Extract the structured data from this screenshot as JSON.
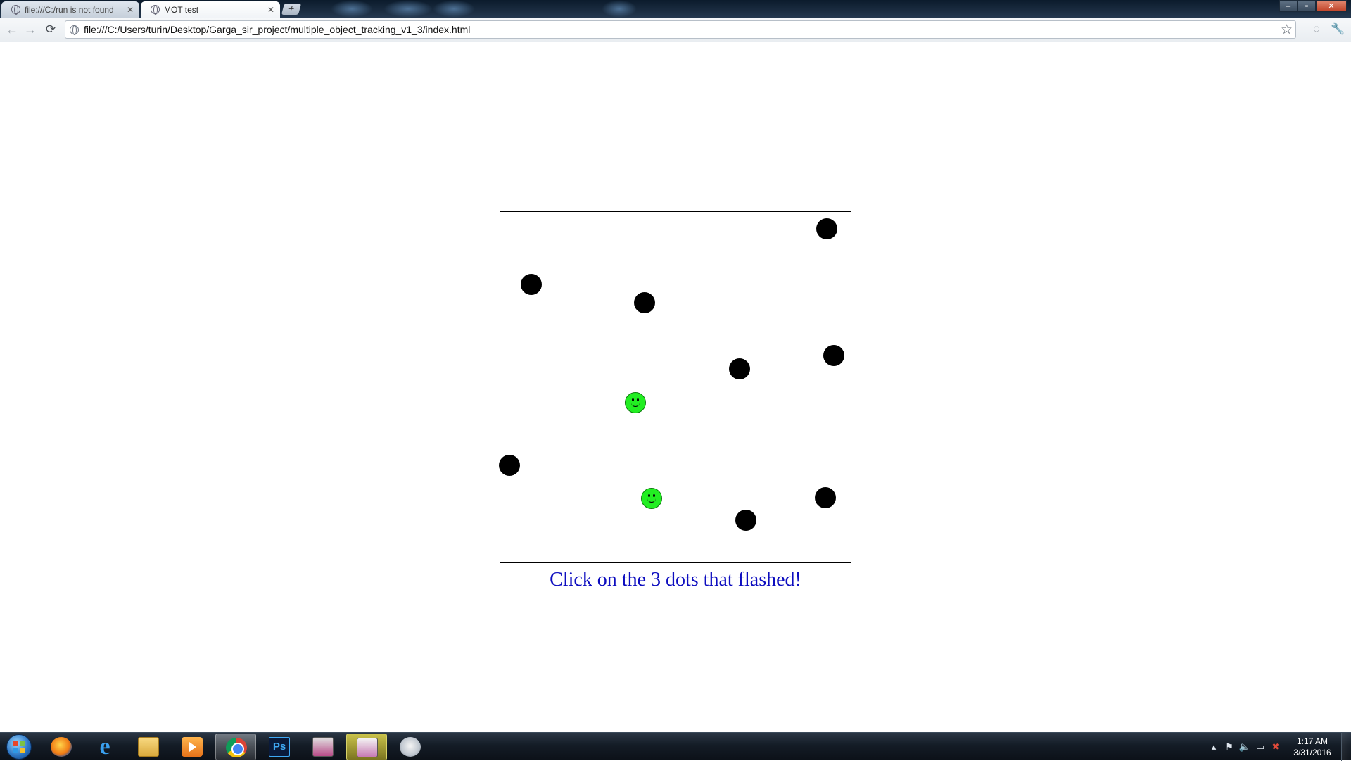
{
  "browser": {
    "tabs": [
      {
        "label": "file:///C:/run is not found",
        "active": false
      },
      {
        "label": "MOT test",
        "active": true
      }
    ],
    "new_tab_glyph": "+",
    "window_controls": {
      "minimize": "–",
      "maximize": "▫",
      "close": "✕"
    },
    "toolbar": {
      "back_glyph": "←",
      "forward_glyph": "→",
      "reload_glyph": "⟳",
      "url": "file:///C:/Users/turin/Desktop/Garga_sir_project/multiple_object_tracking_v1_3/index.html",
      "star_glyph": "☆",
      "extension_glyph": "◌",
      "wrench_glyph": "🔧"
    }
  },
  "page": {
    "instruction": "Click on the 3 dots that flashed!",
    "colors": {
      "dot": "#000000",
      "selected_dot": "#22ee22",
      "instruction_text": "#0d0dbf"
    }
  },
  "taskbar": {
    "apps": [
      {
        "name": "firefox",
        "icon": "firefox-icon"
      },
      {
        "name": "internet-explorer",
        "icon": "ie-icon",
        "glyph": "e"
      },
      {
        "name": "file-explorer",
        "icon": "folder-icon"
      },
      {
        "name": "media-player",
        "icon": "media-player-icon"
      },
      {
        "name": "chrome",
        "icon": "chrome-icon"
      },
      {
        "name": "photoshop",
        "icon": "photoshop-icon",
        "glyph": "Ps"
      },
      {
        "name": "app-4-red",
        "icon": "app-icon"
      },
      {
        "name": "app-4-purple",
        "icon": "app-icon"
      },
      {
        "name": "paint",
        "icon": "paint-icon"
      }
    ],
    "tray": {
      "show_hidden_glyph": "▴",
      "flag_glyph": "⚑",
      "volume_glyph": "🔈",
      "network_glyph": "▭",
      "alert_glyph": "✖"
    },
    "clock": {
      "time": "1:17 AM",
      "date": "3/31/2016"
    }
  }
}
